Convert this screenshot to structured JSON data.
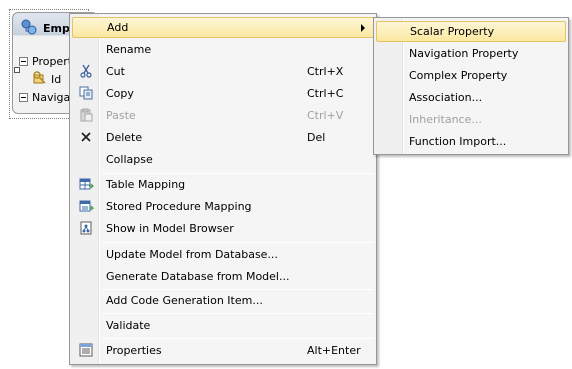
{
  "entity": {
    "title": "Empl",
    "properties_label": "Propert",
    "id_label": "Id",
    "navigation_label": "Navigat"
  },
  "context_menu": {
    "items": [
      {
        "label": "Add",
        "shortcut": "",
        "icon": "",
        "has_submenu": true
      },
      {
        "label": "Rename",
        "shortcut": "",
        "icon": ""
      },
      {
        "label": "Cut",
        "shortcut": "Ctrl+X",
        "icon": "scissors-icon"
      },
      {
        "label": "Copy",
        "shortcut": "Ctrl+C",
        "icon": "copy-icon"
      },
      {
        "label": "Paste",
        "shortcut": "Ctrl+V",
        "icon": "paste-icon",
        "disabled": true
      },
      {
        "label": "Delete",
        "shortcut": "Del",
        "icon": "delete-x-icon"
      },
      {
        "label": "Collapse",
        "shortcut": "",
        "icon": ""
      },
      {
        "label": "Table Mapping",
        "shortcut": "",
        "icon": "table-mapping-icon"
      },
      {
        "label": "Stored Procedure Mapping",
        "shortcut": "",
        "icon": "stored-procedure-mapping-icon"
      },
      {
        "label": "Show in Model Browser",
        "shortcut": "",
        "icon": "model-browser-icon"
      },
      {
        "label": "Update Model from Database...",
        "shortcut": "",
        "icon": ""
      },
      {
        "label": "Generate Database from Model...",
        "shortcut": "",
        "icon": ""
      },
      {
        "label": "Add Code Generation Item...",
        "shortcut": "",
        "icon": ""
      },
      {
        "label": "Validate",
        "shortcut": "",
        "icon": ""
      },
      {
        "label": "Properties",
        "shortcut": "Alt+Enter",
        "icon": "properties-icon"
      }
    ]
  },
  "add_submenu": {
    "items": [
      {
        "label": "Scalar Property"
      },
      {
        "label": "Navigation Property"
      },
      {
        "label": "Complex Property"
      },
      {
        "label": "Association..."
      },
      {
        "label": "Inheritance...",
        "disabled": true
      },
      {
        "label": "Function Import..."
      }
    ]
  },
  "colors": {
    "highlight_top": "#fdf6d6",
    "highlight_bottom": "#fbe8a0",
    "highlight_border": "#e5c365",
    "menu_background": "#f5f5f5",
    "disabled_text": "#a0a0a0"
  }
}
